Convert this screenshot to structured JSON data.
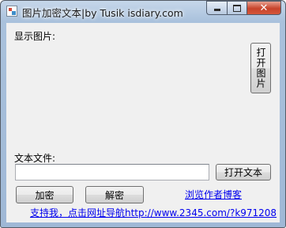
{
  "window": {
    "title": "图片加密文本|by Tusik isdiary.com",
    "icon": "app-image-icon"
  },
  "caption_buttons": {
    "minimize_icon": "minimize-icon",
    "maximize_icon": "maximize-icon",
    "close_symbol": "✕"
  },
  "form": {
    "image_label": "显示图片:",
    "open_image_button": "打开图片",
    "text_file_label": "文本文件:",
    "text_file_value": "",
    "open_text_button": "打开文本",
    "encrypt_button": "加密",
    "decrypt_button": "解密",
    "blog_link": "浏览作者博客",
    "support_link": "支持我，点击网址导航http://www.2345.com/?k971208"
  }
}
